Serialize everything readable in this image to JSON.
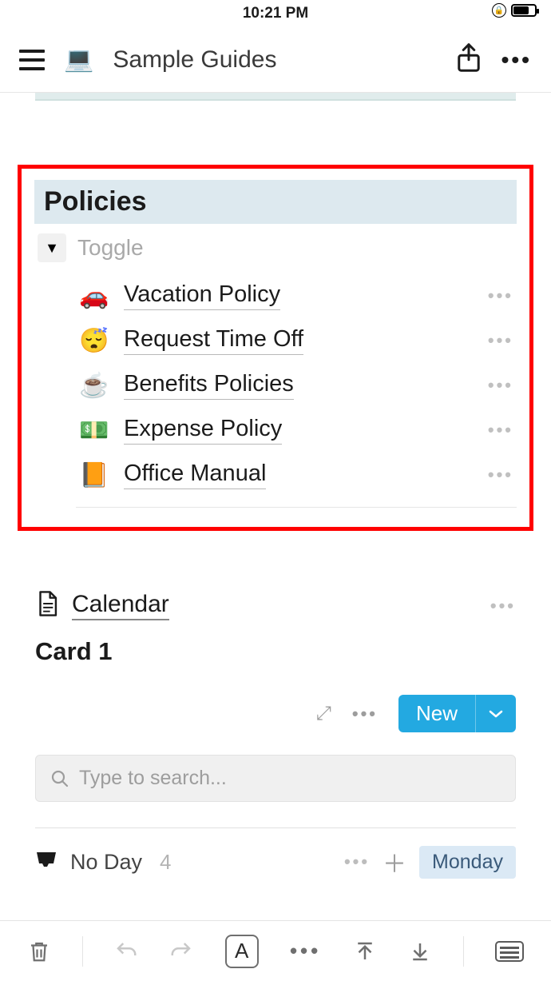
{
  "status": {
    "time": "10:21 PM"
  },
  "header": {
    "icon": "💻",
    "title": "Sample Guides"
  },
  "policies": {
    "heading": "Policies",
    "toggle_label": "Toggle",
    "items": [
      {
        "emoji": "🚗",
        "title": "Vacation Policy"
      },
      {
        "emoji": "😴",
        "title": "Request Time Off"
      },
      {
        "emoji": "☕",
        "title": "Benefits Policies"
      },
      {
        "emoji": "💵",
        "title": "Expense Policy"
      },
      {
        "emoji": "📙",
        "title": "Office Manual"
      }
    ]
  },
  "calendar": {
    "label": "Calendar",
    "card_title": "Card 1",
    "new_label": "New",
    "search_placeholder": "Type to search...",
    "noday_label": "No Day",
    "noday_count": "4",
    "day_badge": "Monday"
  },
  "toolbar": {
    "font_label": "A"
  }
}
